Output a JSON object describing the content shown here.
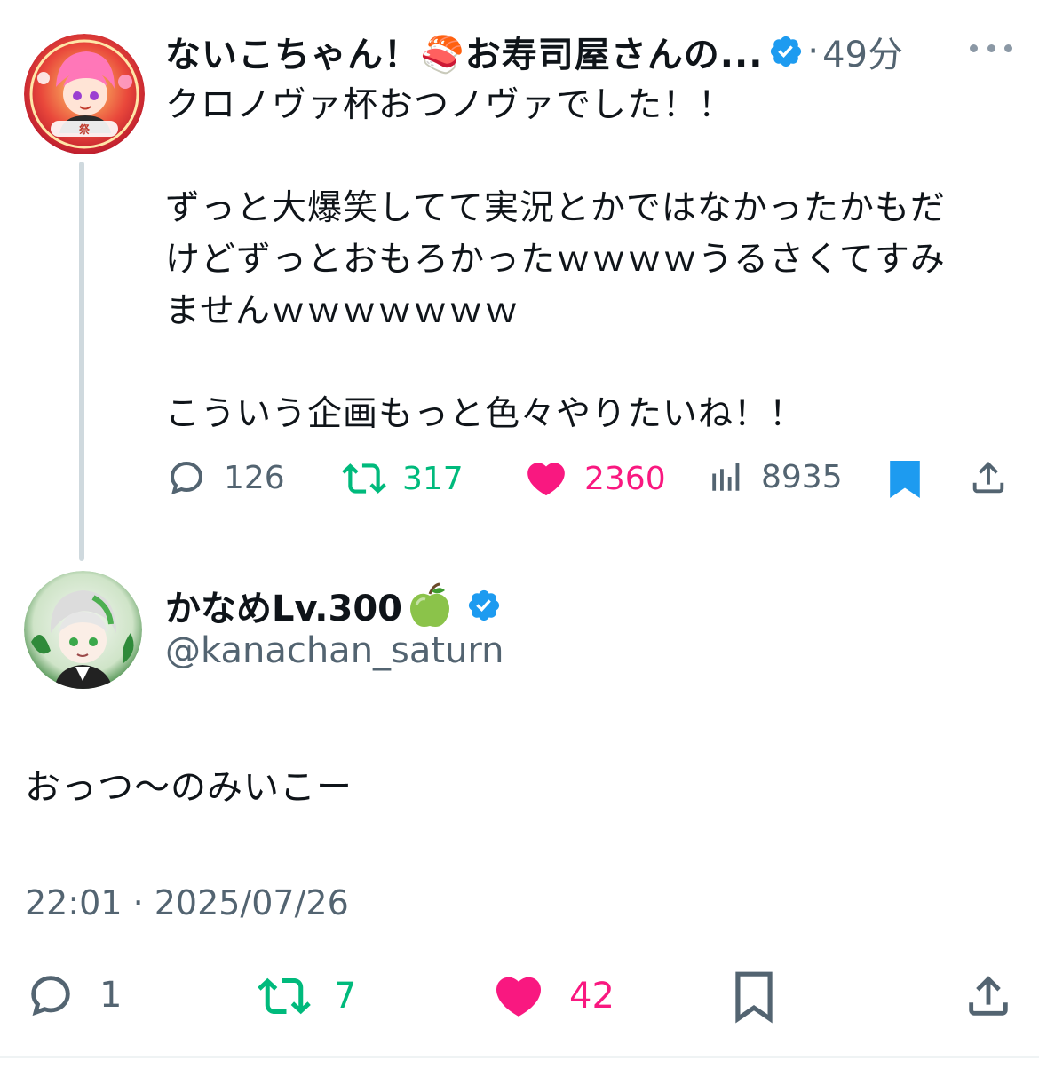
{
  "parent_tweet": {
    "display_name": "ないこちゃん！🍣お寿司屋さんの...",
    "time_separator": "·",
    "time": "49分",
    "lines": [
      "クロノヴァ杯おつノヴァでした！！",
      "",
      "ずっと大爆笑してて実況とかではなかったかもだ",
      "けどずっとおもろかったｗｗｗｗうるさくてすみ",
      "ませんｗｗｗｗｗｗｗ",
      "",
      "こういう企画もっと色々やりたいね！！"
    ],
    "stats": {
      "replies": "126",
      "retweets": "317",
      "likes": "2360",
      "views": "8935"
    },
    "bookmarked": true
  },
  "reply_tweet": {
    "display_name": "かなめLv.300",
    "handle": "@kanachan_saturn",
    "text": "おっつ〜のみいこー",
    "timestamp": "22:01 · 2025/07/26",
    "stats": {
      "replies": "1",
      "retweets": "7",
      "likes": "42"
    },
    "bookmarked": false
  },
  "colors": {
    "text": "#0f1419",
    "secondary": "#536471",
    "verified": "#1d9bf0",
    "retweet": "#00ba7c",
    "like": "#f91880",
    "thread_line": "#cfd9de"
  },
  "icons": [
    "verified-icon",
    "more-icon",
    "reply-icon",
    "retweet-icon",
    "like-icon",
    "views-icon",
    "bookmark-icon",
    "share-icon",
    "green-apple-icon"
  ]
}
